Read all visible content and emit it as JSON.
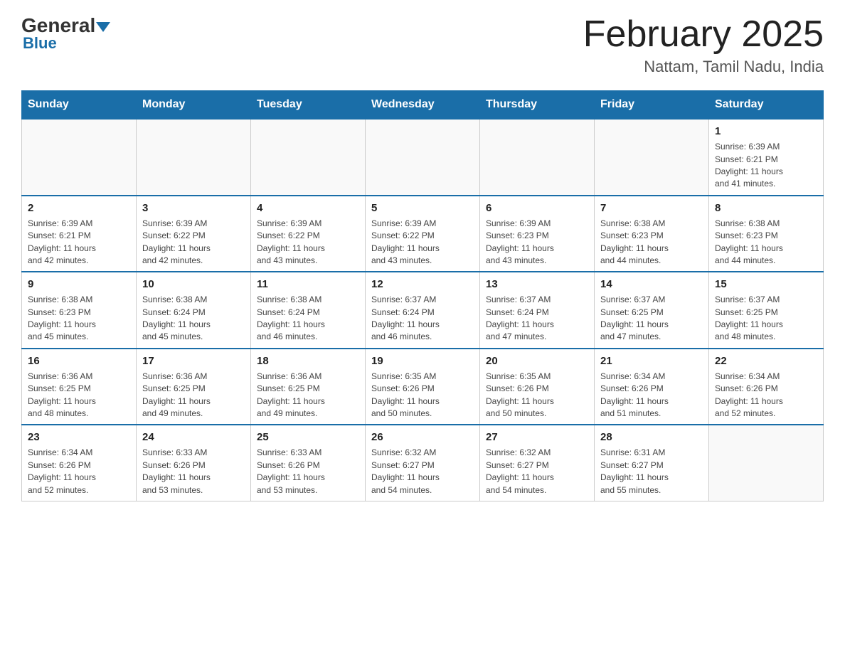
{
  "header": {
    "logo_general": "General",
    "logo_blue": "Blue",
    "month_title": "February 2025",
    "location": "Nattam, Tamil Nadu, India"
  },
  "weekdays": [
    "Sunday",
    "Monday",
    "Tuesday",
    "Wednesday",
    "Thursday",
    "Friday",
    "Saturday"
  ],
  "weeks": [
    [
      {
        "day": "",
        "info": ""
      },
      {
        "day": "",
        "info": ""
      },
      {
        "day": "",
        "info": ""
      },
      {
        "day": "",
        "info": ""
      },
      {
        "day": "",
        "info": ""
      },
      {
        "day": "",
        "info": ""
      },
      {
        "day": "1",
        "info": "Sunrise: 6:39 AM\nSunset: 6:21 PM\nDaylight: 11 hours\nand 41 minutes."
      }
    ],
    [
      {
        "day": "2",
        "info": "Sunrise: 6:39 AM\nSunset: 6:21 PM\nDaylight: 11 hours\nand 42 minutes."
      },
      {
        "day": "3",
        "info": "Sunrise: 6:39 AM\nSunset: 6:22 PM\nDaylight: 11 hours\nand 42 minutes."
      },
      {
        "day": "4",
        "info": "Sunrise: 6:39 AM\nSunset: 6:22 PM\nDaylight: 11 hours\nand 43 minutes."
      },
      {
        "day": "5",
        "info": "Sunrise: 6:39 AM\nSunset: 6:22 PM\nDaylight: 11 hours\nand 43 minutes."
      },
      {
        "day": "6",
        "info": "Sunrise: 6:39 AM\nSunset: 6:23 PM\nDaylight: 11 hours\nand 43 minutes."
      },
      {
        "day": "7",
        "info": "Sunrise: 6:38 AM\nSunset: 6:23 PM\nDaylight: 11 hours\nand 44 minutes."
      },
      {
        "day": "8",
        "info": "Sunrise: 6:38 AM\nSunset: 6:23 PM\nDaylight: 11 hours\nand 44 minutes."
      }
    ],
    [
      {
        "day": "9",
        "info": "Sunrise: 6:38 AM\nSunset: 6:23 PM\nDaylight: 11 hours\nand 45 minutes."
      },
      {
        "day": "10",
        "info": "Sunrise: 6:38 AM\nSunset: 6:24 PM\nDaylight: 11 hours\nand 45 minutes."
      },
      {
        "day": "11",
        "info": "Sunrise: 6:38 AM\nSunset: 6:24 PM\nDaylight: 11 hours\nand 46 minutes."
      },
      {
        "day": "12",
        "info": "Sunrise: 6:37 AM\nSunset: 6:24 PM\nDaylight: 11 hours\nand 46 minutes."
      },
      {
        "day": "13",
        "info": "Sunrise: 6:37 AM\nSunset: 6:24 PM\nDaylight: 11 hours\nand 47 minutes."
      },
      {
        "day": "14",
        "info": "Sunrise: 6:37 AM\nSunset: 6:25 PM\nDaylight: 11 hours\nand 47 minutes."
      },
      {
        "day": "15",
        "info": "Sunrise: 6:37 AM\nSunset: 6:25 PM\nDaylight: 11 hours\nand 48 minutes."
      }
    ],
    [
      {
        "day": "16",
        "info": "Sunrise: 6:36 AM\nSunset: 6:25 PM\nDaylight: 11 hours\nand 48 minutes."
      },
      {
        "day": "17",
        "info": "Sunrise: 6:36 AM\nSunset: 6:25 PM\nDaylight: 11 hours\nand 49 minutes."
      },
      {
        "day": "18",
        "info": "Sunrise: 6:36 AM\nSunset: 6:25 PM\nDaylight: 11 hours\nand 49 minutes."
      },
      {
        "day": "19",
        "info": "Sunrise: 6:35 AM\nSunset: 6:26 PM\nDaylight: 11 hours\nand 50 minutes."
      },
      {
        "day": "20",
        "info": "Sunrise: 6:35 AM\nSunset: 6:26 PM\nDaylight: 11 hours\nand 50 minutes."
      },
      {
        "day": "21",
        "info": "Sunrise: 6:34 AM\nSunset: 6:26 PM\nDaylight: 11 hours\nand 51 minutes."
      },
      {
        "day": "22",
        "info": "Sunrise: 6:34 AM\nSunset: 6:26 PM\nDaylight: 11 hours\nand 52 minutes."
      }
    ],
    [
      {
        "day": "23",
        "info": "Sunrise: 6:34 AM\nSunset: 6:26 PM\nDaylight: 11 hours\nand 52 minutes."
      },
      {
        "day": "24",
        "info": "Sunrise: 6:33 AM\nSunset: 6:26 PM\nDaylight: 11 hours\nand 53 minutes."
      },
      {
        "day": "25",
        "info": "Sunrise: 6:33 AM\nSunset: 6:26 PM\nDaylight: 11 hours\nand 53 minutes."
      },
      {
        "day": "26",
        "info": "Sunrise: 6:32 AM\nSunset: 6:27 PM\nDaylight: 11 hours\nand 54 minutes."
      },
      {
        "day": "27",
        "info": "Sunrise: 6:32 AM\nSunset: 6:27 PM\nDaylight: 11 hours\nand 54 minutes."
      },
      {
        "day": "28",
        "info": "Sunrise: 6:31 AM\nSunset: 6:27 PM\nDaylight: 11 hours\nand 55 minutes."
      },
      {
        "day": "",
        "info": ""
      }
    ]
  ]
}
